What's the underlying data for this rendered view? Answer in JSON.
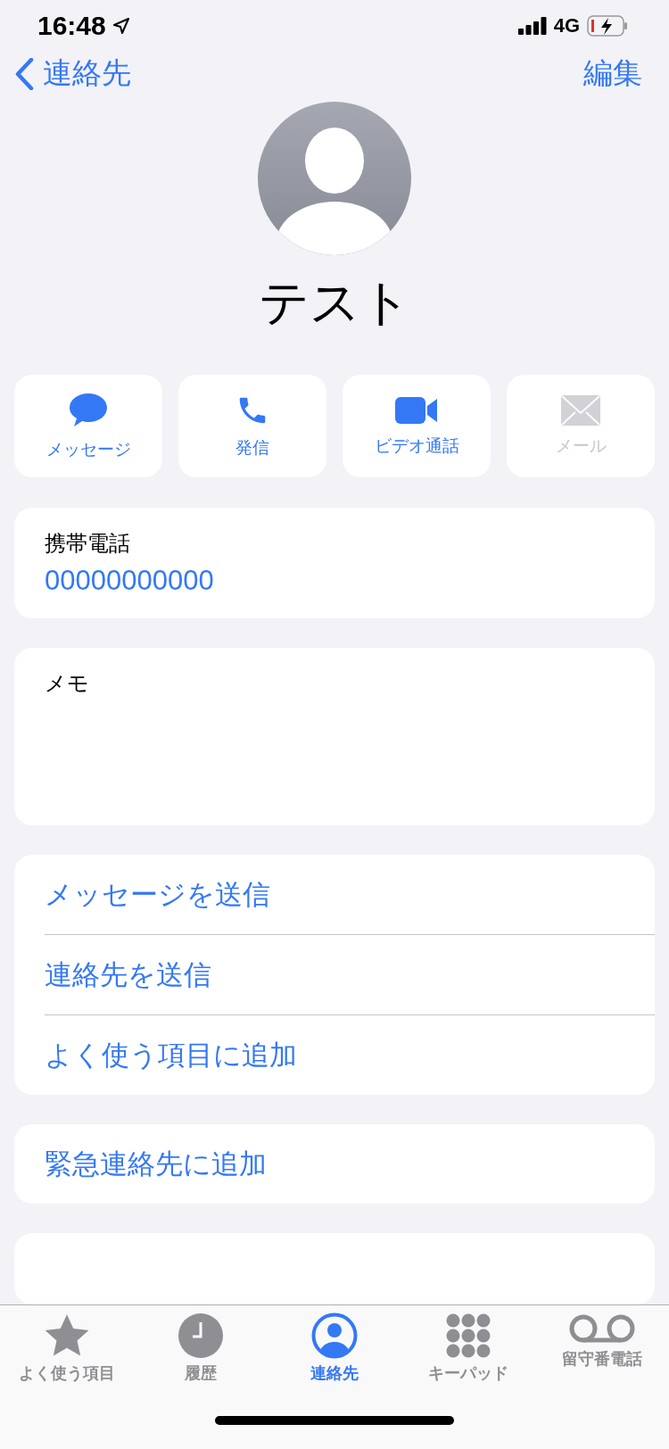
{
  "status_bar": {
    "time": "16:48",
    "network": "4G"
  },
  "nav": {
    "back": "連絡先",
    "edit": "編集"
  },
  "contact": {
    "name": "テスト"
  },
  "actions": [
    {
      "kind": "message",
      "label": "メッセージ",
      "disabled": false
    },
    {
      "kind": "phone",
      "label": "発信",
      "disabled": false
    },
    {
      "kind": "video",
      "label": "ビデオ通話",
      "disabled": false
    },
    {
      "kind": "mail",
      "label": "メール",
      "disabled": true
    }
  ],
  "phone": {
    "label": "携帯電話",
    "value": "00000000000"
  },
  "memo": {
    "label": "メモ"
  },
  "action_list": [
    "メッセージを送信",
    "連絡先を送信",
    "よく使う項目に追加"
  ],
  "emergency": "緊急連絡先に追加",
  "tabs": [
    {
      "kind": "star",
      "label": "よく使う項目",
      "selected": false
    },
    {
      "kind": "clock",
      "label": "履歴",
      "selected": false
    },
    {
      "kind": "person",
      "label": "連絡先",
      "selected": true
    },
    {
      "kind": "keypad",
      "label": "キーパッド",
      "selected": false
    },
    {
      "kind": "voicemail",
      "label": "留守番電話",
      "selected": false
    }
  ]
}
